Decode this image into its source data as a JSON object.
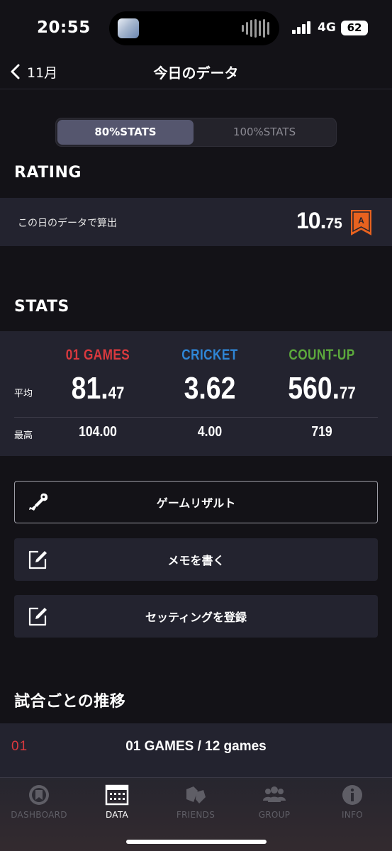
{
  "status_bar": {
    "time": "20:55",
    "network": "4G",
    "battery": "62"
  },
  "nav": {
    "back_label": "11月",
    "title": "今日のデータ"
  },
  "segmented": {
    "options": [
      "80%STATS",
      "100%STATS"
    ],
    "selected": "80%STATS"
  },
  "rating": {
    "section_title": "RATING",
    "caption": "この日のデータで算出",
    "value_int": "10.",
    "value_dec": "75",
    "grade": "A",
    "grade_color": "#e8621f"
  },
  "stats": {
    "section_title": "STATS",
    "row_labels": {
      "average": "平均",
      "max": "最高"
    },
    "columns": [
      {
        "name": "01 GAMES",
        "color": "#d9393e",
        "avg_int": "81.",
        "avg_dec": "47",
        "max": "104.00"
      },
      {
        "name": "CRICKET",
        "color": "#2f86d6",
        "avg_int": "3.62",
        "avg_dec": "",
        "max": "4.00"
      },
      {
        "name": "COUNT-UP",
        "color": "#5ca93c",
        "avg_int": "560.",
        "avg_dec": "77",
        "max": "719"
      }
    ]
  },
  "actions": [
    {
      "label": "ゲームリザルト",
      "icon": "dart-icon"
    },
    {
      "label": "メモを書く",
      "icon": "edit-icon"
    },
    {
      "label": "セッティングを登録",
      "icon": "edit-icon"
    }
  ],
  "trends": {
    "section_title": "試合ごとの推移",
    "code": "01",
    "title": "01 GAMES / 12 games"
  },
  "tabs": [
    {
      "label": "DASHBOARD",
      "icon": "dashboard-icon",
      "active": false
    },
    {
      "label": "DATA",
      "icon": "data-icon",
      "active": true
    },
    {
      "label": "FRIENDS",
      "icon": "friends-icon",
      "active": false
    },
    {
      "label": "GROUP",
      "icon": "group-icon",
      "active": false
    },
    {
      "label": "INFO",
      "icon": "info-icon",
      "active": false
    }
  ]
}
